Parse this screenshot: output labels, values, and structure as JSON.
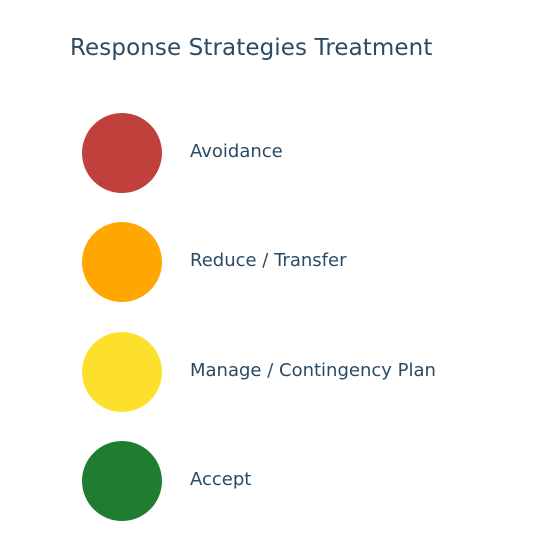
{
  "title": "Response Strategies Treatment",
  "items": [
    {
      "label": "Avoidance",
      "color": "#c0403b"
    },
    {
      "label": "Reduce / Transfer",
      "color": "#ffa600"
    },
    {
      "label": "Manage / Contingency Plan",
      "color": "#fde02c"
    },
    {
      "label": "Accept",
      "color": "#1f7d32"
    }
  ]
}
